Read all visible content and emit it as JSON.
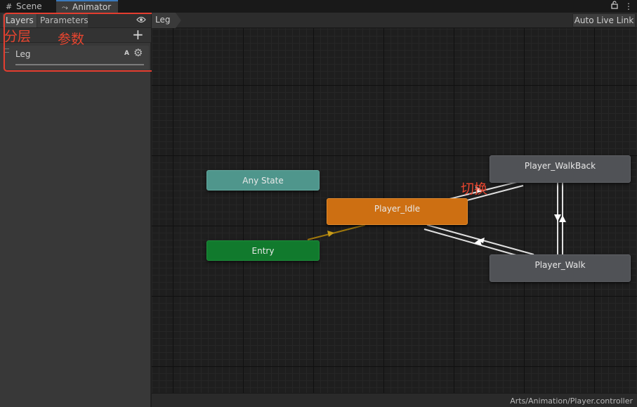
{
  "tabs": {
    "scene": {
      "icon": "grid-icon",
      "label": "Scene"
    },
    "animator": {
      "icon": "animator-icon",
      "label": "Animator"
    }
  },
  "window_controls": {
    "lock": "lock-icon",
    "menu": "kebab-menu-icon"
  },
  "left_panel": {
    "tabs": {
      "layers": "Layers",
      "parameters": "Parameters"
    },
    "eye_icon": "eye-icon",
    "add_icon": "plus-icon",
    "layer": {
      "name": "Leg",
      "badge": "A",
      "settings_icon": "gear-icon"
    }
  },
  "annotations": {
    "layers_note": "分层",
    "params_note": "参数",
    "transition_note": "切换",
    "color": "#e43d2f"
  },
  "breadcrumb": {
    "layer": "Leg"
  },
  "toolbar": {
    "auto_live_link": "Auto Live Link"
  },
  "graph": {
    "states": {
      "any_state": {
        "label": "Any State",
        "color": "#4f968c"
      },
      "entry": {
        "label": "Entry",
        "color": "#117a2d"
      },
      "idle": {
        "label": "Player_Idle",
        "color": "#cd6f12",
        "default": true
      },
      "walkback": {
        "label": "Player_WalkBack",
        "color": "#505256"
      },
      "walk": {
        "label": "Player_Walk",
        "color": "#505256"
      }
    },
    "transitions": [
      {
        "from": "Entry",
        "to": "Player_Idle"
      },
      {
        "from": "Player_Idle",
        "to": "Player_WalkBack"
      },
      {
        "from": "Player_WalkBack",
        "to": "Player_Idle"
      },
      {
        "from": "Player_Idle",
        "to": "Player_Walk"
      },
      {
        "from": "Player_Walk",
        "to": "Player_Idle"
      },
      {
        "from": "Player_Walk",
        "to": "Player_WalkBack"
      },
      {
        "from": "Player_WalkBack",
        "to": "Player_Walk"
      }
    ]
  },
  "status": {
    "path": "Arts/Animation/Player.controller"
  }
}
